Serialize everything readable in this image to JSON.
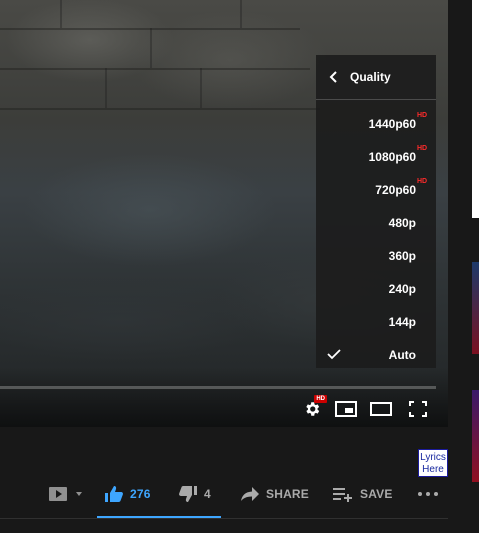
{
  "player": {
    "menu": {
      "title": "Quality",
      "options": [
        {
          "label": "1440p60",
          "hd": "HD",
          "selected": false
        },
        {
          "label": "1080p60",
          "hd": "HD",
          "selected": false
        },
        {
          "label": "720p60",
          "hd": "HD",
          "selected": false
        },
        {
          "label": "480p",
          "hd": "",
          "selected": false
        },
        {
          "label": "360p",
          "hd": "",
          "selected": false
        },
        {
          "label": "240p",
          "hd": "",
          "selected": false
        },
        {
          "label": "144p",
          "hd": "",
          "selected": false
        },
        {
          "label": "Auto",
          "hd": "",
          "selected": true
        }
      ]
    },
    "settings_badge": "HD",
    "icons": [
      "settings-icon",
      "miniplayer-icon",
      "theater-mode-icon",
      "fullscreen-icon"
    ]
  },
  "overlay": {
    "lyrics_line1": "Lyrics",
    "lyrics_line2": "Here"
  },
  "actions": {
    "like_count": "276",
    "dislike_count": "4",
    "share_label": "SHARE",
    "save_label": "SAVE"
  },
  "colors": {
    "accent": "#3ea6ff",
    "hd_red": "#cc0000",
    "menu_bg": "#1c1c1c",
    "page_bg": "#181818"
  }
}
